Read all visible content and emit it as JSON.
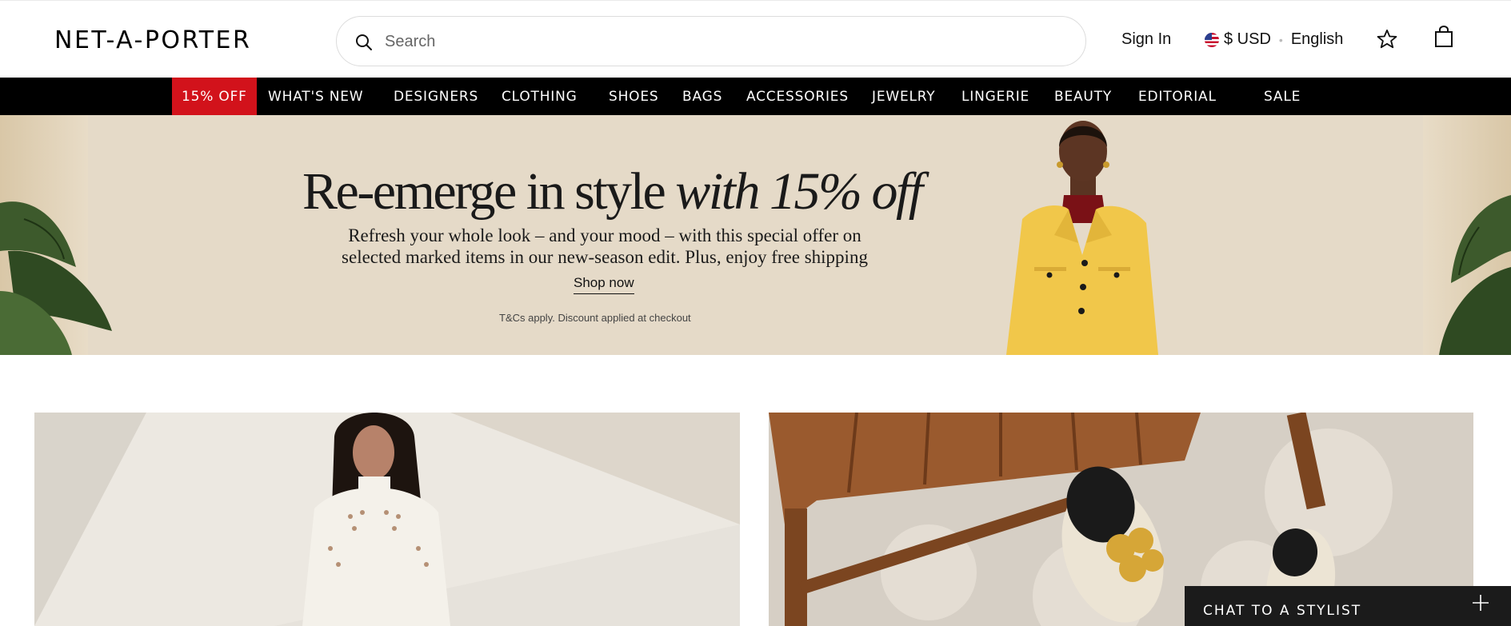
{
  "header": {
    "logo": "NET-A-PORTER",
    "search_placeholder": "Search",
    "sign_in": "Sign In",
    "currency": "$ USD",
    "language": "English",
    "icons": [
      "search-icon",
      "flag-us-icon",
      "star-icon",
      "shopping-bag-icon"
    ]
  },
  "nav": {
    "items": [
      {
        "label": "15% OFF",
        "promo": true
      },
      {
        "label": "WHAT'S NEW"
      },
      {
        "label": "DESIGNERS"
      },
      {
        "label": "CLOTHING"
      },
      {
        "label": "SHOES"
      },
      {
        "label": "BAGS"
      },
      {
        "label": "ACCESSORIES"
      },
      {
        "label": "JEWELRY"
      },
      {
        "label": "LINGERIE"
      },
      {
        "label": "BEAUTY"
      },
      {
        "label": "EDITORIAL"
      },
      {
        "label": "SALE"
      }
    ]
  },
  "hero": {
    "title_plain": "Re-emerge in style ",
    "title_italic": "with 15% off",
    "subtitle_line1": "Refresh your whole look – and your mood – with this special offer on",
    "subtitle_line2": "selected marked items in our new-season edit. Plus, enjoy free shipping",
    "cta": "Shop now",
    "terms": "T&Cs apply. Discount applied at checkout"
  },
  "chat": {
    "label": "CHAT TO A STYLIST"
  },
  "colors": {
    "promo_red": "#d2121b",
    "nav_bg": "#000000",
    "hero_bg": "#e5dac8",
    "chat_bg": "#1b1b1b"
  }
}
